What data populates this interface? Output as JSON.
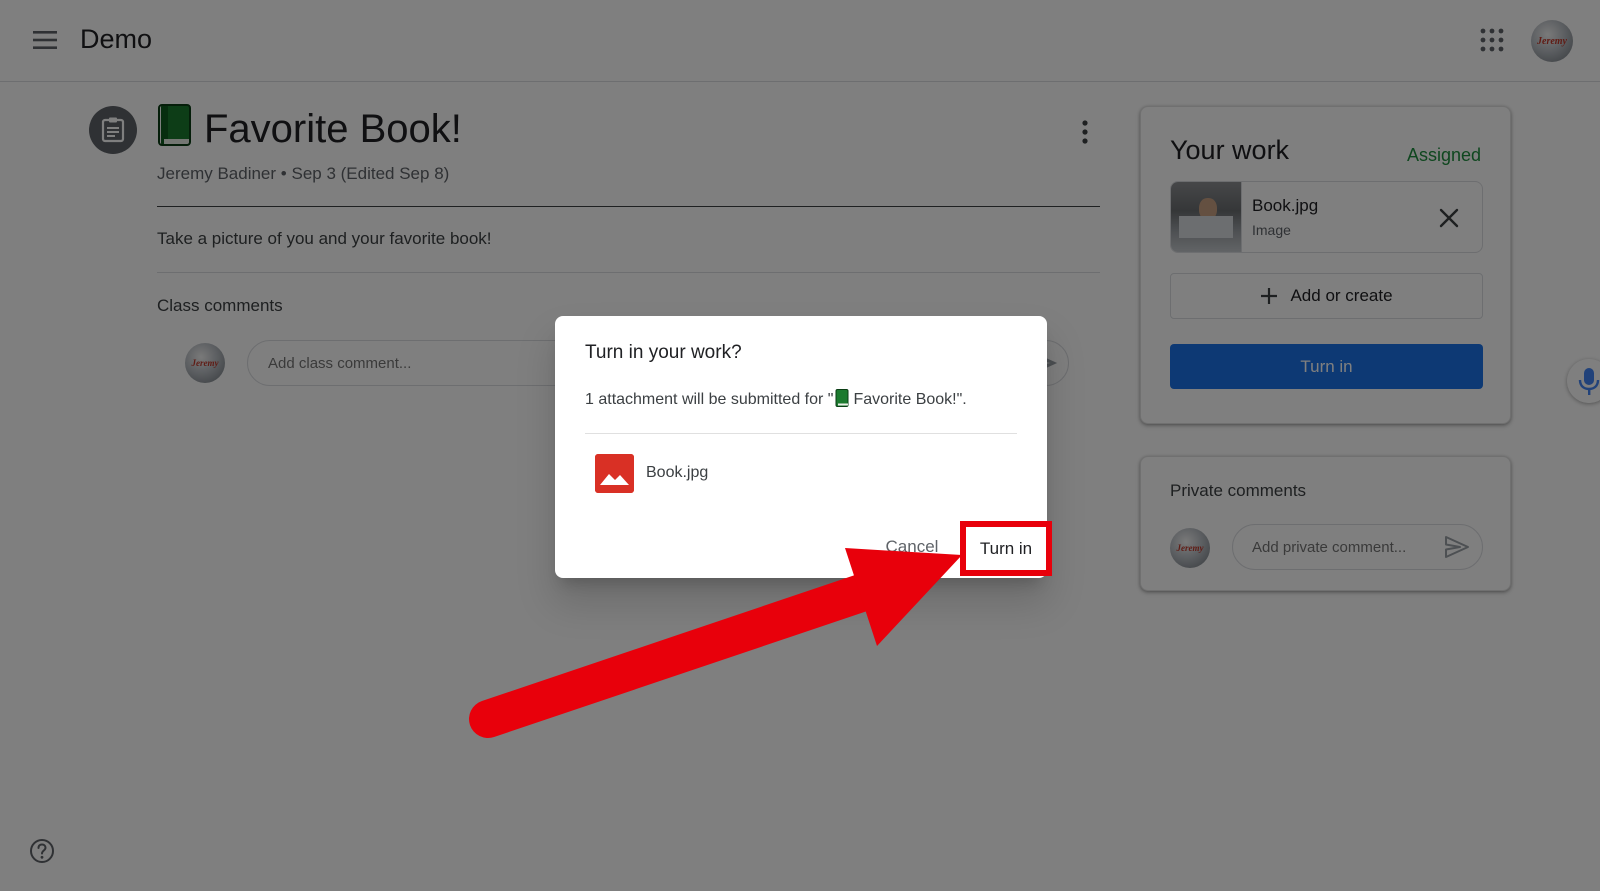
{
  "header": {
    "app_title": "Demo",
    "avatar_text": "Jeremy"
  },
  "assignment": {
    "title": "Favorite Book!",
    "title_emoji": "green-book-icon",
    "author": "Jeremy Badiner",
    "separator": "•",
    "date": "Sep 3 (Edited Sep 8)",
    "instructions": "Take a picture of you and your favorite book!"
  },
  "class_comments": {
    "label": "Class comments",
    "placeholder": "Add class comment..."
  },
  "your_work": {
    "title": "Your work",
    "status": "Assigned",
    "attachment": {
      "name": "Book.jpg",
      "type": "Image"
    },
    "add_create_label": "Add or create",
    "turn_in_label": "Turn in"
  },
  "private_comments": {
    "label": "Private comments",
    "placeholder": "Add private comment..."
  },
  "dialog": {
    "title": "Turn in your work?",
    "message_prefix": "1 attachment will be submitted for \"",
    "message_subject": "Favorite Book!",
    "message_suffix": "\".",
    "file_name": "Book.jpg",
    "cancel_label": "Cancel",
    "confirm_label": "Turn in"
  },
  "colors": {
    "accent_blue": "#1a73e8",
    "status_green": "#1e8e3e",
    "highlight_red": "#e8000b",
    "image_file_red": "#d93025",
    "scrim": "rgba(0,0,0,0.5)"
  },
  "icons": [
    "menu-icon",
    "apps-grid-icon",
    "assignment-icon",
    "more-vert-icon",
    "close-icon",
    "plus-icon",
    "send-icon",
    "image-file-icon",
    "help-icon",
    "microphone-icon",
    "annotation-arrow"
  ]
}
